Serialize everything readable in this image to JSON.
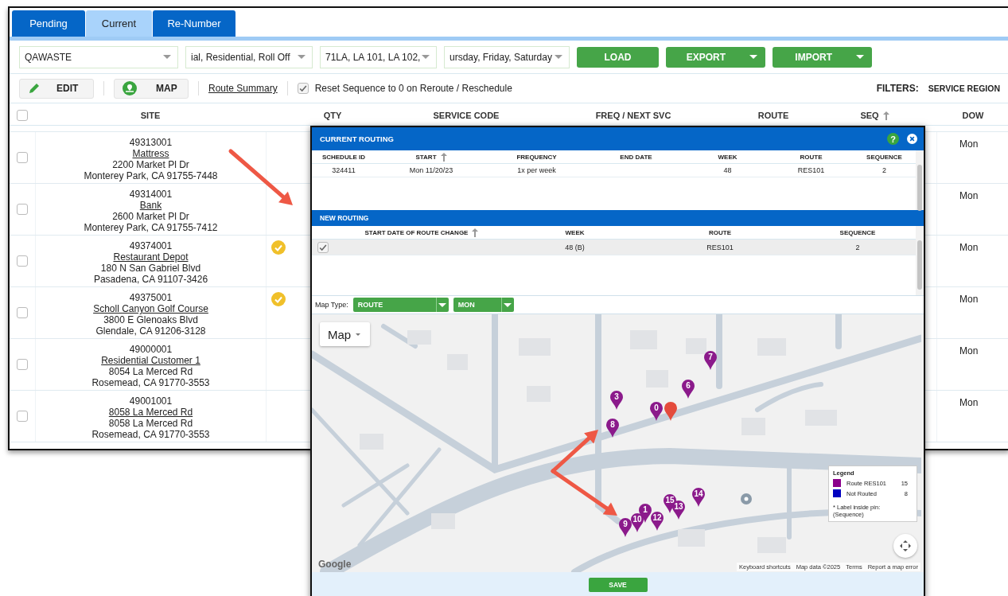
{
  "tabs": [
    {
      "label": "Pending",
      "selected": false
    },
    {
      "label": "Current",
      "selected": true
    },
    {
      "label": "Re-Number",
      "selected": false
    }
  ],
  "filters": {
    "selects": [
      "QAWASTE",
      "ial, Residential, Roll Off",
      "71LA, LA 101, LA 102,",
      "ursday, Friday, Saturday"
    ],
    "buttons": [
      {
        "label": "LOAD",
        "dropdown": false
      },
      {
        "label": "EXPORT",
        "dropdown": true
      },
      {
        "label": "IMPORT",
        "dropdown": true
      }
    ]
  },
  "toolbar": {
    "edit_button": "EDIT",
    "map_button": "MAP",
    "route_summary_link": "Route Summary",
    "reset_sequence": {
      "label": "Reset Sequence to 0 on Reroute / Reschedule",
      "checked": true
    },
    "filters_label": "FILTERS:",
    "filters_value": "SERVICE REGION"
  },
  "table": {
    "select_all_checked": false,
    "columns": [
      {
        "label": "SITE",
        "sorted": false
      },
      {
        "label": "QTY",
        "sorted": false
      },
      {
        "label": "SERVICE CODE",
        "sorted": false
      },
      {
        "label": "FREQ / NEXT SVC",
        "sorted": false
      },
      {
        "label": "ROUTE",
        "sorted": false
      },
      {
        "label": "SEQ",
        "sorted": true
      },
      {
        "label": "DOW",
        "sorted": false
      }
    ],
    "rows": [
      {
        "checked": false,
        "id": "49313001",
        "name": "Mattress",
        "address": "2200 Market Pl Dr",
        "city": "Monterey Park, CA 91755-7448",
        "verified": false,
        "dow": "Mon"
      },
      {
        "checked": false,
        "id": "49314001",
        "name": "Bank",
        "address": "2600 Market Pl Dr",
        "city": "Monterey Park, CA 91755-7412",
        "verified": false,
        "dow": "Mon"
      },
      {
        "checked": false,
        "id": "49374001",
        "name": "Restaurant Depot",
        "address": "180 N San Gabriel Blvd",
        "city": "Pasadena, CA 91107-3426",
        "verified": true,
        "dow": "Mon"
      },
      {
        "checked": false,
        "id": "49375001",
        "name": "Scholl Canyon Golf Course",
        "address": "3800 E Glenoaks Blvd",
        "city": "Glendale, CA 91206-3128",
        "verified": true,
        "dow": "Mon"
      },
      {
        "checked": false,
        "id": "49000001",
        "name": "Residential Customer 1",
        "address": "8054 La Merced Rd",
        "city": "Rosemead, CA 91770-3553",
        "verified": false,
        "dow": "Mon"
      },
      {
        "checked": false,
        "id": "49001001",
        "name": "8058 La Merced Rd",
        "address": "8058 La Merced Rd",
        "city": "Rosemead, CA 91770-3553",
        "verified": false,
        "dow": "Mon"
      }
    ]
  },
  "dialog": {
    "title": "CURRENT ROUTING",
    "help": "?",
    "current_routing": {
      "columns": [
        {
          "label": "SCHEDULE ID",
          "sorted": false
        },
        {
          "label": "START",
          "sorted": true
        },
        {
          "label": "FREQUENCY",
          "sorted": false
        },
        {
          "label": "END DATE",
          "sorted": false
        },
        {
          "label": "WEEK",
          "sorted": false
        },
        {
          "label": "ROUTE",
          "sorted": false
        },
        {
          "label": "SEQUENCE",
          "sorted": false
        }
      ],
      "rows": [
        [
          "324411",
          "Mon 11/20/23",
          "1x per week",
          null,
          "48",
          "RES101",
          "2"
        ]
      ]
    },
    "new_routing": {
      "title": "NEW ROUTING",
      "columns": [
        {
          "label": "START DATE OF ROUTE CHANGE",
          "sorted": true
        },
        {
          "label": "WEEK",
          "sorted": false
        },
        {
          "label": "ROUTE",
          "sorted": false
        },
        {
          "label": "SEQUENCE",
          "sorted": false
        }
      ],
      "rows": [
        {
          "checked": true,
          "selected": true,
          "cells": [
            "",
            "48 (B)",
            "RES101",
            "2"
          ]
        }
      ]
    },
    "map_type": {
      "label": "Map Type:",
      "selects": [
        "ROUTE",
        "MON"
      ]
    },
    "map": {
      "type_button": "Map",
      "pins": [
        {
          "kind": "route",
          "label": "7"
        },
        {
          "kind": "route",
          "label": "6"
        },
        {
          "kind": "route",
          "label": "3"
        },
        {
          "kind": "route",
          "label": "0"
        },
        {
          "kind": "current"
        },
        {
          "kind": "route",
          "label": "8"
        },
        {
          "kind": "route",
          "label": "9"
        },
        {
          "kind": "route",
          "label": "10"
        },
        {
          "kind": "route",
          "label": "1"
        },
        {
          "kind": "route",
          "label": "12"
        },
        {
          "kind": "route",
          "label": "15"
        },
        {
          "kind": "route",
          "label": "13"
        },
        {
          "kind": "route",
          "label": "14"
        }
      ],
      "legend": {
        "title": "Legend",
        "items": [
          {
            "label": "Route RES101",
            "count": "15",
            "color": "#8b008b"
          },
          {
            "label": "Not Routed",
            "count": "8",
            "color": "#0000c0"
          }
        ],
        "note": "* Label inside pin: (Sequence)"
      },
      "logo": "Google",
      "attribution": [
        "Keyboard shortcuts",
        "Map data ©2025",
        "Terms",
        "Report a map error"
      ]
    },
    "save_button": "SAVE"
  }
}
